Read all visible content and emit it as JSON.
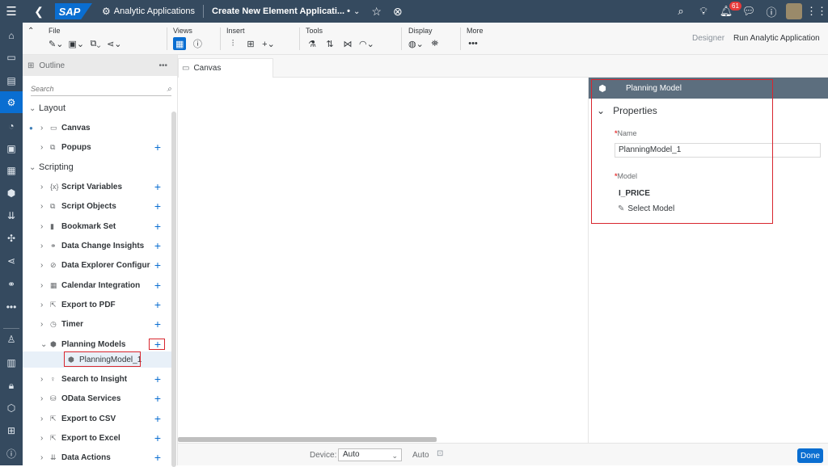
{
  "shell": {
    "logo": "SAP",
    "app_name": "Analytic Applications",
    "document_title": "Create New Element Applicati... •",
    "notification_count": "61"
  },
  "toolbar": {
    "groups": {
      "file": "File",
      "views": "Views",
      "insert": "Insert",
      "tools": "Tools",
      "display": "Display",
      "more": "More"
    },
    "designer": "Designer",
    "run_app": "Run Analytic Application"
  },
  "outline": {
    "title": "Outline",
    "search_placeholder": "Search",
    "items": {
      "layout": "Layout",
      "canvas": "Canvas",
      "popups": "Popups",
      "scripting": "Scripting",
      "script_variables": "Script Variables",
      "script_objects": "Script Objects",
      "bookmark_set": "Bookmark Set",
      "data_change_insights": "Data Change Insights",
      "data_explorer": "Data Explorer Configurat",
      "calendar_integration": "Calendar Integration",
      "export_pdf": "Export to PDF",
      "timer": "Timer",
      "planning_models": "Planning Models",
      "planning_model_1": "PlanningModel_1",
      "search_to_insight": "Search to Insight",
      "odata_services": "OData Services",
      "export_csv": "Export to CSV",
      "export_excel": "Export to Excel",
      "data_actions": "Data Actions"
    }
  },
  "canvas_tab": "Canvas",
  "footer": {
    "device_label": "Device:",
    "device_value": "Auto",
    "auto_label": "Auto",
    "done": "Done"
  },
  "properties": {
    "header": "Planning Model",
    "section": "Properties",
    "name_label": "Name",
    "name_value": "PlanningModel_1",
    "model_label": "Model",
    "model_value": "I_PRICE",
    "select_model": "Select Model"
  }
}
